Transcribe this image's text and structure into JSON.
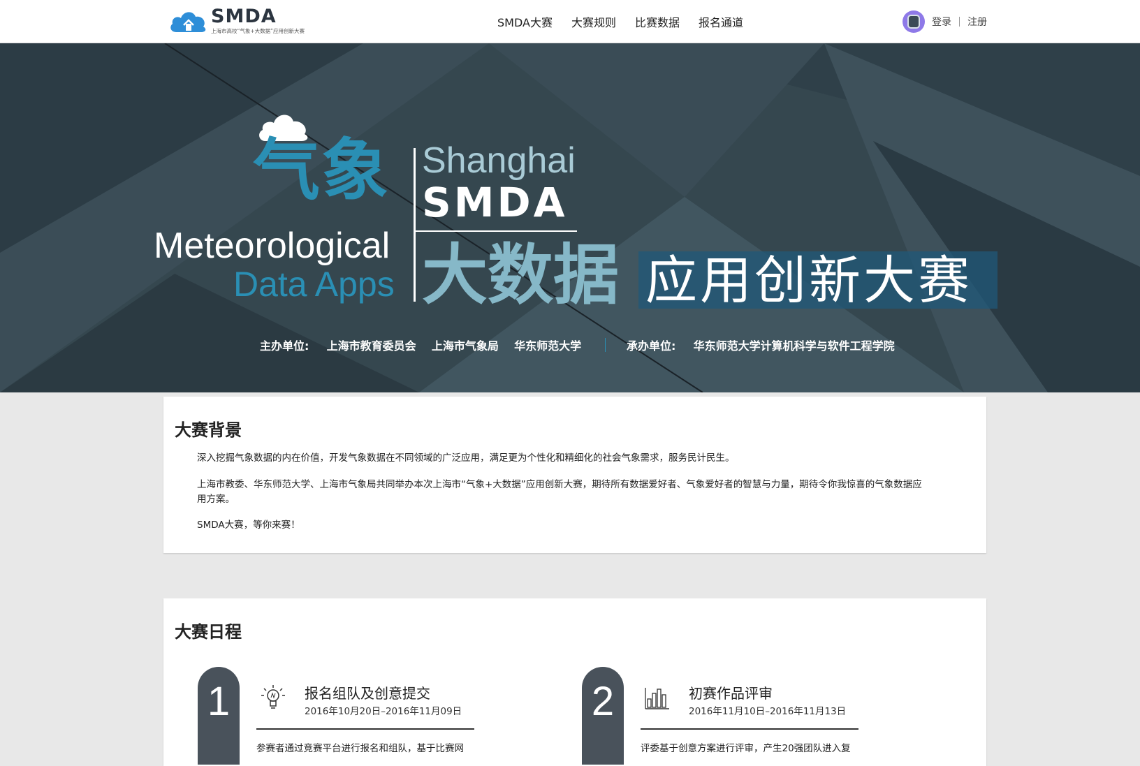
{
  "header": {
    "logo_text": "SMDA",
    "logo_subtitle": "上海市高校“气象+大数据”应用创新大赛",
    "nav": [
      "SMDA大赛",
      "大赛规则",
      "比赛数据",
      "报名通道"
    ],
    "login": "登录",
    "register": "注册"
  },
  "hero": {
    "title_cn_1": "气象",
    "title_shanghai": "Shanghai",
    "title_smda": "SMDA",
    "title_meteorological": "Meteorological",
    "title_data_apps": "Data Apps",
    "title_cn_2": "大数据",
    "title_cn_3": "应用创新大赛",
    "host_label": "主办单位:",
    "hosts": "上海市教育委员会    上海市气象局    华东师范大学",
    "organizer_label": "承办单位:",
    "organizer": "华东师范大学计算机科学与软件工程学院",
    "colors": {
      "accent_blue": "#2a8fb4",
      "light_blue": "#86b8c8",
      "banner_bg": "#33444f"
    }
  },
  "background_section": {
    "title": "大赛背景",
    "paragraphs": [
      "深入挖掘气象数据的内在价值，开发气象数据在不同领域的广泛应用，满足更为个性化和精细化的社会气象需求，服务民计民生。",
      "上海市教委、华东师范大学、上海市气象局共同举办本次上海市“气象+大数据”应用创新大赛，期待所有数据爱好者、气象爱好者的智慧与力量，期待令你我惊喜的气象数据应",
      "用方案。",
      "SMDA大赛，等你来赛！"
    ]
  },
  "schedule_section": {
    "title": "大赛日程",
    "steps": [
      {
        "number": "1",
        "icon": "lightbulb-icon",
        "title": "报名组队及创意提交",
        "date": "2016年10月20日–2016年11月09日",
        "desc": "参赛者通过竞赛平台进行报名和组队，基于比赛网"
      },
      {
        "number": "2",
        "icon": "bar-chart-icon",
        "title": "初赛作品评审",
        "date": "2016年11月10日–2016年11月13日",
        "desc": "评委基于创意方案进行评审，产生20强团队进入复"
      }
    ]
  }
}
